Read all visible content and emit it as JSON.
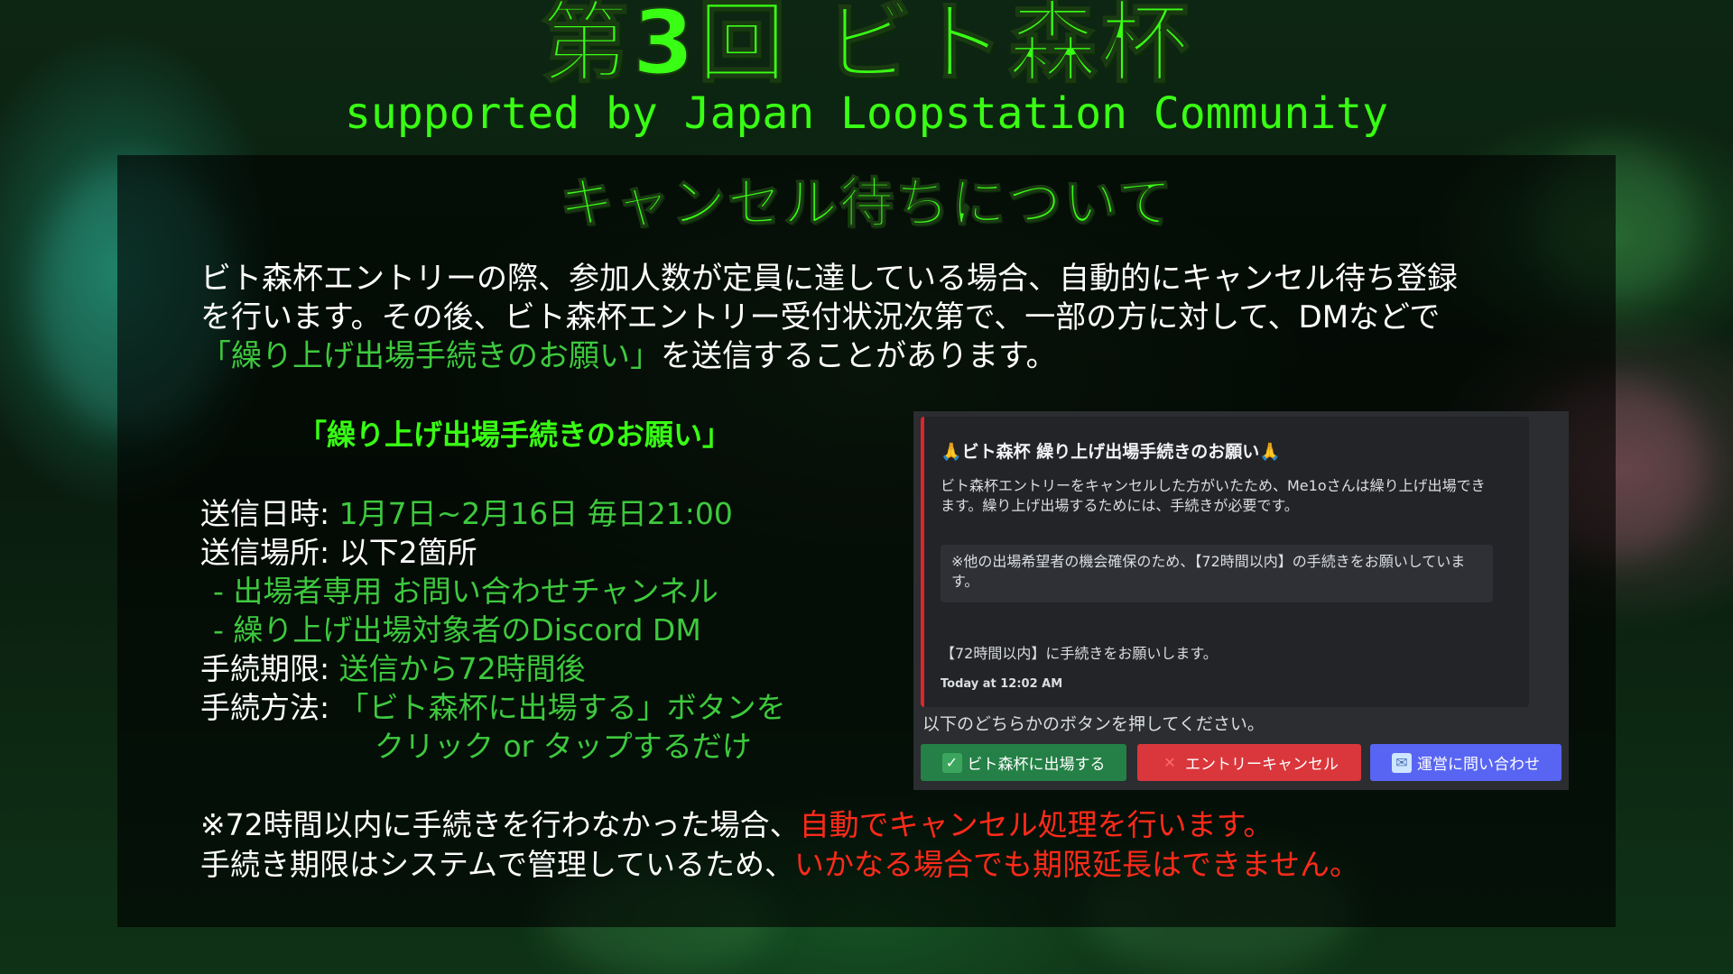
{
  "header": {
    "title": "第3回 ビト森杯",
    "subtitle": "supported by Japan Loopstation Community"
  },
  "section": {
    "title": "キャンセル待ちについて"
  },
  "intro": {
    "line1": "ビト森杯エントリーの際、参加人数が定員に達している場合、自動的にキャンセル待ち登録",
    "line2": "を行います。その後、ビト森杯エントリー受付状況次第で、一部の方に対して、DMなどで",
    "line3_highlight": "「繰り上げ出場手続きのお願い」",
    "line3_rest": "を送信することがあります。"
  },
  "request": {
    "title": "「繰り上げ出場手続きのお願い」",
    "send_date_label": "送信日時: ",
    "send_date_value": "1月7日~2月16日 毎日21:00",
    "send_place_label": "送信場所: 以下2箇所",
    "place1": "- 出場者専用 お問い合わせチャンネル",
    "place2": "- 繰り上げ出場対象者のDiscord DM",
    "deadline_label": "手続期限: ",
    "deadline_value": "送信から72時間後",
    "method_label": "手続方法: ",
    "method_value1": "「ビト森杯に出場する」ボタンを",
    "method_value2": "クリック or タップするだけ"
  },
  "notes": {
    "line1_text": "※72時間以内に手続きを行わなかった場合、",
    "line1_red": "自動でキャンセル処理を行います。",
    "line2_text": "手続き期限はシステムで管理しているため、",
    "line2_red": "いかなる場合でも期限延長はできません。"
  },
  "discord": {
    "embed_title": "🙏ビト森杯 繰り上げ出場手続きのお願い🙏",
    "embed_desc": "ビト森杯エントリーをキャンセルした方がいたため、Me1oさんは繰り上げ出場できます。繰り上げ出場するためには、手続きが必要です。",
    "embed_quote": "※他の出場希望者の機会確保のため、【72時間以内】の手続きをお願いしています。",
    "embed_note": "【72時間以内】に手続きをお願いします。",
    "timestamp": "Today at 12:02 AM",
    "prompt": "以下のどちらかのボタンを押してください。",
    "buttons": {
      "join": "ビト森杯に出場する",
      "cancel": "エントリーキャンセル",
      "contact": "運営に問い合わせ"
    },
    "colors": {
      "embed_bar": "#e0242b",
      "join": "#248046",
      "cancel": "#da373c",
      "contact": "#5865f2"
    }
  },
  "colors": {
    "accent_green": "#39ff14",
    "text_green": "#3ec93e",
    "warning_red": "#ff2a1a"
  }
}
